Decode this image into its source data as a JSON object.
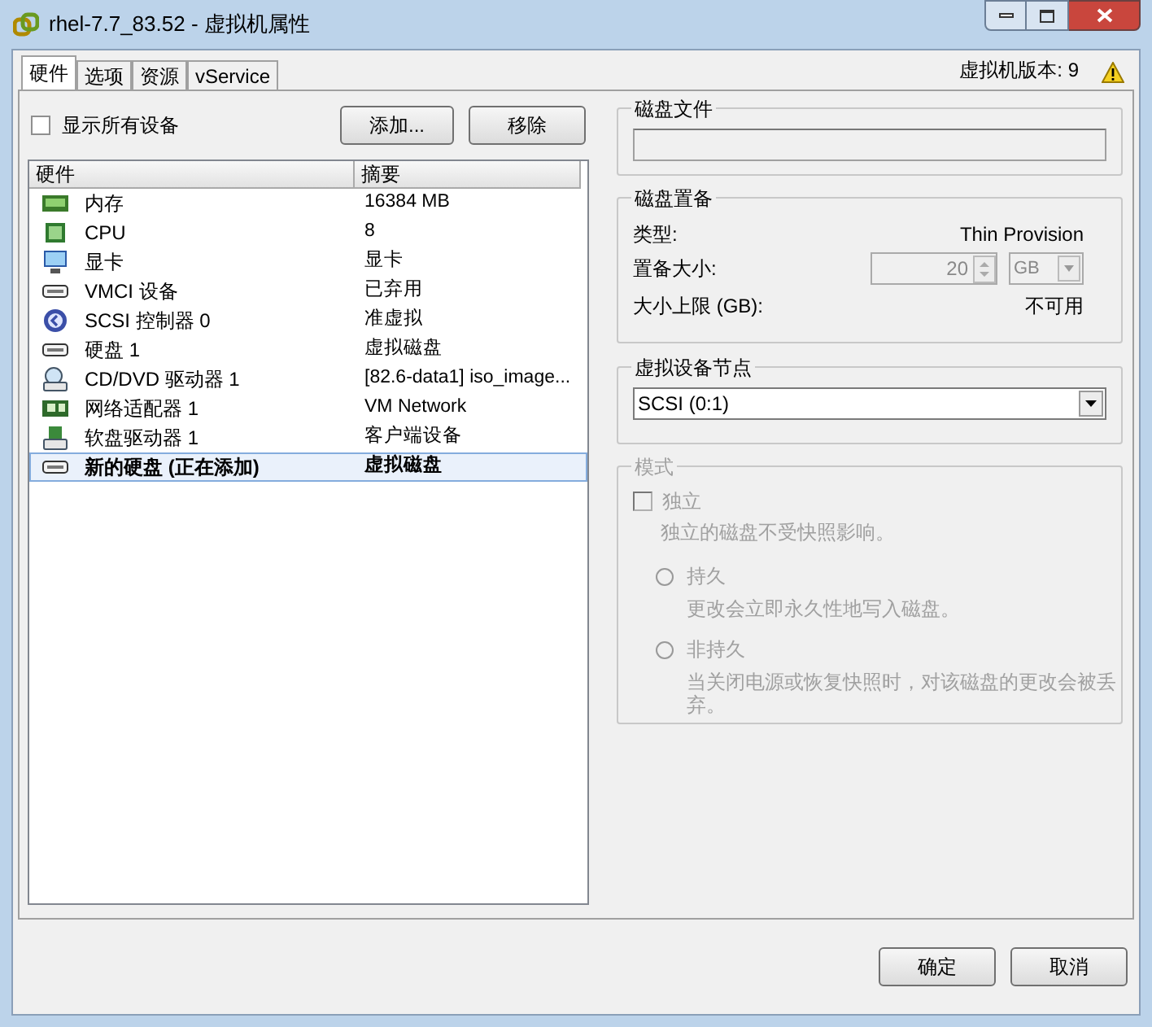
{
  "window": {
    "title": "rhel-7.7_83.52 - 虚拟机属性"
  },
  "tabs": [
    {
      "label": "硬件",
      "selected": true
    },
    {
      "label": "选项",
      "selected": false
    },
    {
      "label": "资源",
      "selected": false
    },
    {
      "label": "vService",
      "selected": false
    }
  ],
  "vm_version": "虚拟机版本: 9",
  "show_all_devices": {
    "label": "显示所有设备",
    "checked": false
  },
  "buttons_top": [
    "添加...",
    "移除"
  ],
  "hardware_table": {
    "columns": [
      "硬件",
      "摘要"
    ],
    "rows": [
      {
        "kind": "memory",
        "name": "内存",
        "summary": "16384 MB",
        "selected": false,
        "adding": false
      },
      {
        "kind": "cpu",
        "name": "CPU",
        "summary": "8",
        "selected": false,
        "adding": false
      },
      {
        "kind": "display",
        "name": "显卡",
        "summary": "显卡",
        "selected": false,
        "adding": false
      },
      {
        "kind": "device",
        "name": "VMCI 设备",
        "summary": "已弃用",
        "selected": false,
        "adding": false
      },
      {
        "kind": "scsi",
        "name": "SCSI 控制器 0",
        "summary": "准虚拟",
        "selected": false,
        "adding": false
      },
      {
        "kind": "device",
        "name": "硬盘 1",
        "summary": "虚拟磁盘",
        "selected": false,
        "adding": false
      },
      {
        "kind": "cdrom",
        "name": "CD/DVD 驱动器 1",
        "summary": "[82.6-data1] iso_image...",
        "selected": false,
        "adding": false
      },
      {
        "kind": "network",
        "name": "网络适配器 1",
        "summary": "VM Network",
        "selected": false,
        "adding": false
      },
      {
        "kind": "floppy",
        "name": "软盘驱动器 1",
        "summary": "客户端设备",
        "selected": false,
        "adding": false
      },
      {
        "kind": "device",
        "name": "新的硬盘 (正在添加)",
        "summary": "虚拟磁盘",
        "selected": true,
        "adding": true
      }
    ]
  },
  "disk_file": {
    "title": "磁盘文件"
  },
  "disk_provisioning": {
    "title": "磁盘置备",
    "type_label": "类型:",
    "type_value": "Thin Provision",
    "size_label": "置备大小:",
    "size_value": "20",
    "size_unit": "GB",
    "max_label": "大小上限 (GB):",
    "max_value": "不可用"
  },
  "device_node": {
    "title": "虚拟设备节点",
    "value": "SCSI (0:1)"
  },
  "mode": {
    "title": "模式",
    "disabled": true,
    "independent": {
      "label": "独立",
      "checked": false,
      "description": "独立的磁盘不受快照影响。"
    },
    "options": [
      {
        "label": "持久",
        "description": "更改会立即永久性地写入磁盘。",
        "selected": false
      },
      {
        "label": "非持久",
        "description": "当关闭电源或恢复快照时，对该磁盘的更改会被丢弃。",
        "selected": false
      }
    ]
  },
  "buttons_bottom": [
    "确定",
    "取消"
  ]
}
